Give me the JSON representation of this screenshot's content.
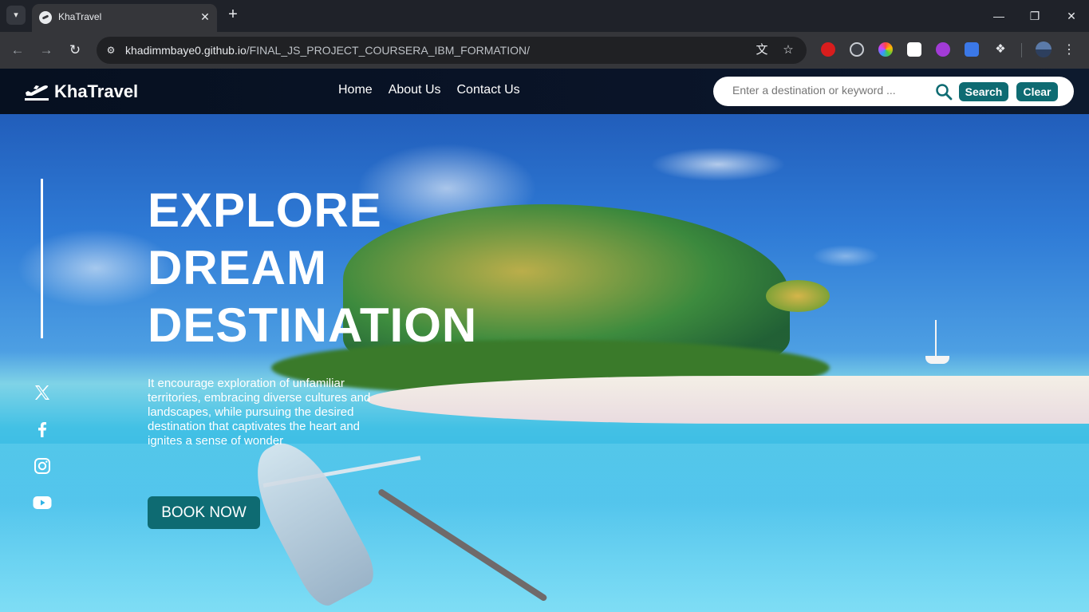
{
  "browser": {
    "tab_title": "KhaTravel",
    "url_host": "khadimmbaye0.github.io",
    "url_path": "/FINAL_JS_PROJECT_COURSERA_IBM_FORMATION/",
    "icons": [
      "tab-search-icon",
      "close-icon",
      "plus-icon",
      "minimize-icon",
      "restore-icon",
      "close-window-icon",
      "back-icon",
      "forward-icon",
      "reload-icon",
      "site-info-icon",
      "translate-icon",
      "star-icon",
      "extensions-icon",
      "profile-icon",
      "menu-icon"
    ]
  },
  "header": {
    "logo_text": "KhaTravel",
    "nav": [
      "Home",
      "About Us",
      "Contact Us"
    ],
    "search": {
      "placeholder": "Enter a destination or keyword ...",
      "value": "",
      "search_label": "Search",
      "clear_label": "Clear"
    }
  },
  "hero": {
    "title_lines": [
      "EXPLORE",
      "DREAM",
      "DESTINATION"
    ],
    "description": "It encourage exploration of unfamiliar territories, embracing diverse cultures and landscapes, while pursuing the desired destination that captivates the heart and ignites a sense of wonder",
    "cta_label": "BOOK NOW"
  },
  "social": [
    "x-icon",
    "facebook-icon",
    "instagram-icon",
    "youtube-icon"
  ],
  "colors": {
    "accent": "#0e6b72",
    "header_bg": "#061020",
    "text": "#ffffff"
  }
}
